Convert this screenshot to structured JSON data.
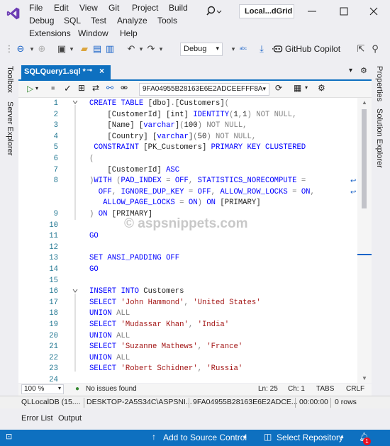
{
  "menu": {
    "row1": [
      "File",
      "Edit",
      "View",
      "Git",
      "Project",
      "Build"
    ],
    "row2": [
      "Debug",
      "SQL",
      "Test",
      "Analyze",
      "Tools"
    ],
    "row3": [
      "Extensions",
      "Window",
      "Help"
    ]
  },
  "title": "Local...dGrid",
  "toolbar": {
    "config": "Debug",
    "copilot": "GitHub Copilot"
  },
  "side_panels": {
    "left": [
      "Toolbox",
      "Server Explorer"
    ],
    "right": [
      "Properties",
      "Solution Explorer"
    ]
  },
  "document_tab": {
    "title": "SQLQuery1.sql *",
    "close_glyph": "×"
  },
  "editor_toolbar": {
    "connection": "9FA04955B28163E6E2ADCEEFFF8A"
  },
  "editor": {
    "line_numbers": [
      "1",
      "2",
      "3",
      "4",
      "5",
      "6",
      "7",
      "8",
      "",
      "",
      "9",
      "10",
      "11",
      "12",
      "13",
      "14",
      "15",
      "16",
      "17",
      "18",
      "19",
      "20",
      "21",
      "22",
      "23",
      "24"
    ],
    "lines": [
      [
        [
          "kw",
          "CREATE TABLE "
        ],
        [
          "plain",
          "[dbo]"
        ],
        [
          "gray",
          "."
        ],
        [
          "plain",
          "[Customers]"
        ],
        [
          "gray",
          "("
        ]
      ],
      [
        [
          "plain",
          "    [CustomerId] [int] "
        ],
        [
          "kw",
          "IDENTITY"
        ],
        [
          "gray",
          "("
        ],
        [
          "plain",
          "1"
        ],
        [
          "gray",
          ","
        ],
        [
          "plain",
          "1"
        ],
        [
          "gray",
          ") "
        ],
        [
          "gray",
          "NOT NULL"
        ],
        [
          "gray",
          ","
        ]
      ],
      [
        [
          "plain",
          "    [Name] ["
        ],
        [
          "kw",
          "varchar"
        ],
        [
          "plain",
          "]"
        ],
        [
          "gray",
          "("
        ],
        [
          "plain",
          "100"
        ],
        [
          "gray",
          ") NOT NULL,"
        ]
      ],
      [
        [
          "plain",
          "    [Country] ["
        ],
        [
          "kw",
          "varchar"
        ],
        [
          "plain",
          "]"
        ],
        [
          "gray",
          "("
        ],
        [
          "plain",
          "50"
        ],
        [
          "gray",
          ") NOT NULL,"
        ]
      ],
      [
        [
          "kw",
          " CONSTRAINT "
        ],
        [
          "plain",
          "[PK_Customers] "
        ],
        [
          "kw",
          "PRIMARY KEY CLUSTERED"
        ]
      ],
      [
        [
          "gray",
          "("
        ]
      ],
      [
        [
          "plain",
          "    [CustomerId] "
        ],
        [
          "kw",
          "ASC"
        ]
      ],
      [
        [
          "gray",
          ")"
        ],
        [
          "kw",
          "WITH "
        ],
        [
          "gray",
          "("
        ],
        [
          "kw",
          "PAD_INDEX "
        ],
        [
          "gray",
          "= "
        ],
        [
          "kw",
          "OFF"
        ],
        [
          "gray",
          ", "
        ],
        [
          "kw",
          "STATISTICS_NORECOMPUTE "
        ],
        [
          "gray",
          "="
        ]
      ],
      [
        [
          "kw",
          "  OFF"
        ],
        [
          "gray",
          ", "
        ],
        [
          "kw",
          "IGNORE_DUP_KEY "
        ],
        [
          "gray",
          "= "
        ],
        [
          "kw",
          "OFF"
        ],
        [
          "gray",
          ", "
        ],
        [
          "kw",
          "ALLOW_ROW_LOCKS "
        ],
        [
          "gray",
          "= "
        ],
        [
          "kw",
          "ON"
        ],
        [
          "gray",
          ","
        ]
      ],
      [
        [
          "kw",
          "   ALLOW_PAGE_LOCKS "
        ],
        [
          "gray",
          "= "
        ],
        [
          "kw",
          "ON"
        ],
        [
          "gray",
          ") "
        ],
        [
          "kw",
          "ON "
        ],
        [
          "plain",
          "[PRIMARY]"
        ]
      ],
      [
        [
          "gray",
          ") "
        ],
        [
          "kw",
          "ON "
        ],
        [
          "plain",
          "[PRIMARY]"
        ]
      ],
      [
        [
          "plain",
          ""
        ]
      ],
      [
        [
          "kw",
          "GO"
        ]
      ],
      [
        [
          "plain",
          ""
        ]
      ],
      [
        [
          "kw",
          "SET ANSI_PADDING OFF"
        ]
      ],
      [
        [
          "kw",
          "GO"
        ]
      ],
      [
        [
          "plain",
          ""
        ]
      ],
      [
        [
          "kw",
          "INSERT INTO "
        ],
        [
          "plain",
          "Customers"
        ]
      ],
      [
        [
          "kw",
          "SELECT "
        ],
        [
          "str",
          "'John Hammond'"
        ],
        [
          "gray",
          ", "
        ],
        [
          "str",
          "'United States'"
        ]
      ],
      [
        [
          "kw",
          "UNION "
        ],
        [
          "gray",
          "ALL"
        ]
      ],
      [
        [
          "kw",
          "SELECT "
        ],
        [
          "str",
          "'Mudassar Khan'"
        ],
        [
          "gray",
          ", "
        ],
        [
          "str",
          "'India'"
        ]
      ],
      [
        [
          "kw",
          "UNION "
        ],
        [
          "gray",
          "ALL"
        ]
      ],
      [
        [
          "kw",
          "SELECT "
        ],
        [
          "str",
          "'Suzanne Mathews'"
        ],
        [
          "gray",
          ", "
        ],
        [
          "str",
          "'France'"
        ]
      ],
      [
        [
          "kw",
          "UNION "
        ],
        [
          "gray",
          "ALL"
        ]
      ],
      [
        [
          "kw",
          "SELECT "
        ],
        [
          "str",
          "'Robert Schidner'"
        ],
        [
          "gray",
          ", "
        ],
        [
          "str",
          "'Russia'"
        ]
      ],
      [
        [
          "plain",
          ""
        ]
      ]
    ],
    "watermark": "© aspsnippets.com"
  },
  "editor_status": {
    "zoom": "100 %",
    "issues": "No issues found",
    "ln": "Ln: 25",
    "ch": "Ch: 1",
    "tabs": "TABS",
    "eol": "CRLF"
  },
  "query_status": {
    "server": "QLLocalDB (15....",
    "user": "DESKTOP-2A5S34C\\ASPSNI...",
    "db": "9FA04955B28163E6E2ADCE...",
    "time": "00:00:00",
    "rows": "0 rows"
  },
  "bottom_tabs": [
    "Error List",
    "Output"
  ],
  "status_bar": {
    "source_control": "Add to Source Control",
    "repository": "Select Repository",
    "notifications": "1"
  },
  "colors": {
    "accent": "#0e70c0",
    "keyword": "#0000ff",
    "string": "#a31515",
    "linenumber": "#237893"
  }
}
